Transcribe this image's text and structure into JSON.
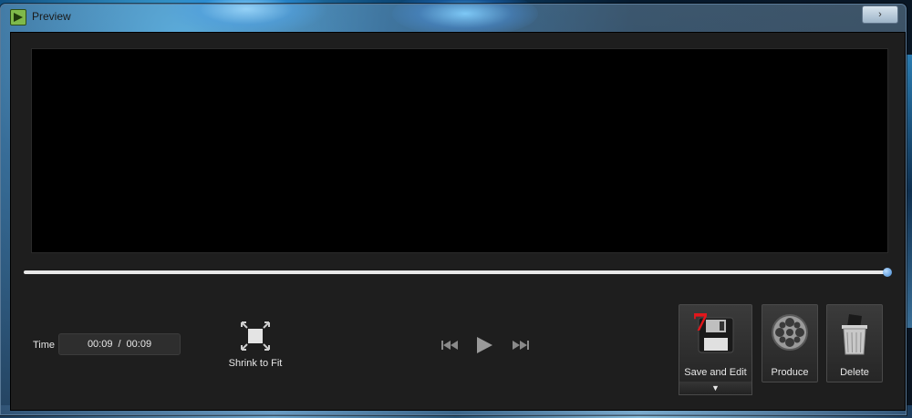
{
  "window": {
    "title": "Preview",
    "close_glyph": "›",
    "accent_color": "#4a90d9"
  },
  "playback": {
    "time_label": "Time",
    "current_time": "00:09",
    "separator": "/",
    "total_time": "00:09",
    "progress": 1.0
  },
  "view": {
    "shrink_label": "Shrink to Fit"
  },
  "actions": {
    "save_label": "Save and Edit",
    "save_dropdown_glyph": "▼",
    "produce_label": "Produce",
    "delete_label": "Delete"
  },
  "annotation": {
    "step_number": "7",
    "color": "#e3161b"
  },
  "icons": {
    "app": "app-logo-icon",
    "shrink": "shrink-to-fit-icon",
    "prev": "skip-back-icon",
    "play": "play-icon",
    "next": "skip-forward-icon",
    "save": "floppy-disk-icon",
    "produce": "film-reel-icon",
    "delete": "trash-can-icon"
  }
}
